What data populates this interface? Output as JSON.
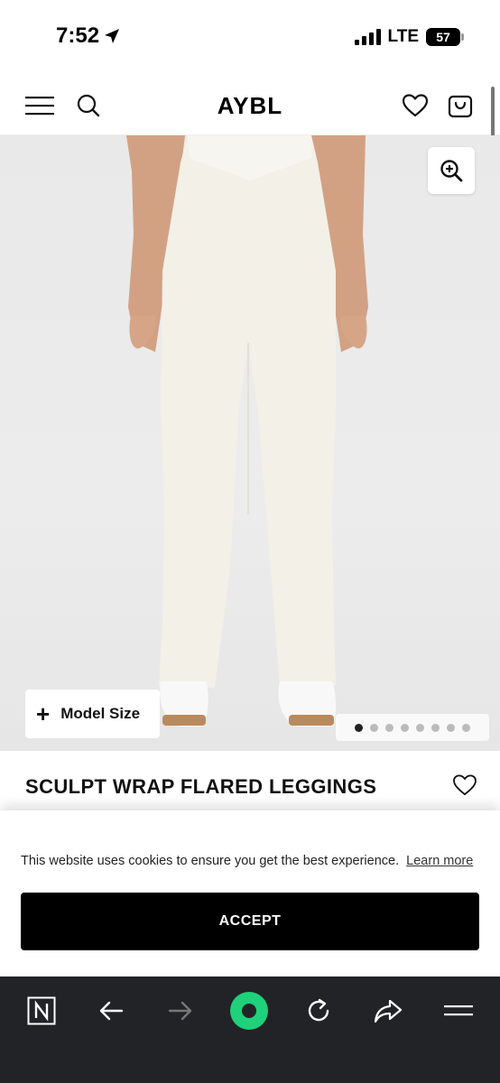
{
  "status_bar": {
    "time": "7:52",
    "network": "LTE",
    "battery": "57"
  },
  "header": {
    "logo": "AYBL",
    "icons": [
      "menu-icon",
      "search-icon",
      "heart-icon",
      "shopping-bag-icon"
    ]
  },
  "product": {
    "image_description_icons": [
      "zoom-in-icon"
    ],
    "model_size_label": "Model Size",
    "gallery_count": 8,
    "gallery_active_index": 0,
    "title": "SCULPT WRAP FLARED LEGGINGS"
  },
  "cookie_banner": {
    "message": "This website uses cookies to ensure you get the best experience.",
    "learn_more": "Learn more",
    "accept_label": "ACCEPT"
  },
  "browser_bar": {
    "icons": [
      "n-app-icon",
      "back-arrow-icon",
      "forward-arrow-icon",
      "record-icon",
      "reload-icon",
      "share-icon",
      "menu-lines-icon"
    ],
    "accent_color": "#1ed17a"
  }
}
